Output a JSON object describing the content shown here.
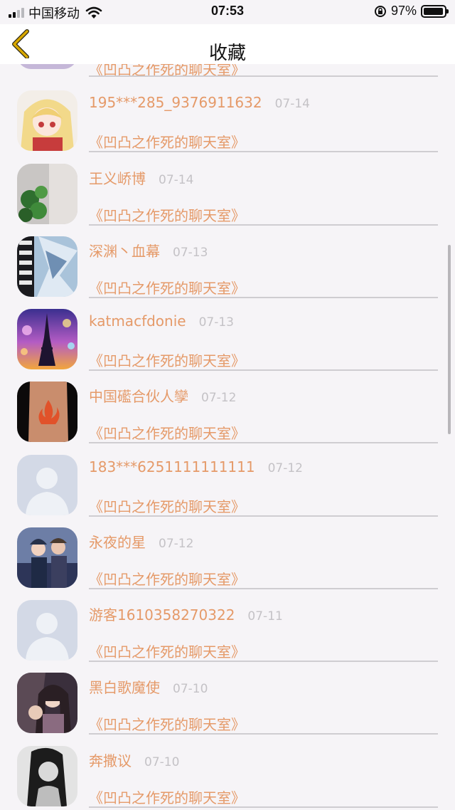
{
  "status_bar": {
    "carrier": "中国移动",
    "time": "07:53",
    "battery": "97%",
    "battery_level": 0.97
  },
  "nav": {
    "title": "收藏",
    "back_icon": "chevron-left-icon"
  },
  "rows": [
    {
      "username": "",
      "date": "",
      "room": "《凹凸之作死的聊天室》",
      "avatar": "landscape-avatar-partial"
    },
    {
      "username": "195***285_9376911632",
      "date": "07-14",
      "room": "《凹凸之作死的聊天室》",
      "avatar": "anime-girl-avatar"
    },
    {
      "username": "王义峤博",
      "date": "07-14",
      "room": "《凹凸之作死的聊天室》",
      "avatar": "clover-avatar"
    },
    {
      "username": "深渊丶血幕",
      "date": "07-13",
      "room": "《凹凸之作死的聊天室》",
      "avatar": "unicorn-text-avatar"
    },
    {
      "username": "katmacfdonie",
      "date": "07-13",
      "room": "《凹凸之作死的聊天室》",
      "avatar": "eiffel-tower-avatar"
    },
    {
      "username": "中国礷合伙人孿",
      "date": "07-12",
      "room": "《凹凸之作死的聊天室》",
      "avatar": "flame-tattoo-avatar"
    },
    {
      "username": "183***6251111111111",
      "date": "07-12",
      "room": "《凹凸之作死的聊天室》",
      "avatar": "default-person-avatar"
    },
    {
      "username": "永夜的星",
      "date": "07-12",
      "room": "《凹凸之作死的聊天室》",
      "avatar": "anime-group-avatar"
    },
    {
      "username": "游客1610358270322",
      "date": "07-11",
      "room": "《凹凸之作死的聊天室》",
      "avatar": "default-person-avatar"
    },
    {
      "username": "黑白歌魔使",
      "date": "07-10",
      "room": "《凹凸之作死的聊天室》",
      "avatar": "anime-couple-avatar"
    },
    {
      "username": "奔撒议",
      "date": "07-10",
      "room": "《凹凸之作死的聊天室》",
      "avatar": "bw-portrait-avatar"
    }
  ],
  "colors": {
    "accent_orange": "#e59a69",
    "date_gray": "#c4c2c6",
    "background": "#f6f4f7",
    "back_arrow": "#d9a800"
  }
}
